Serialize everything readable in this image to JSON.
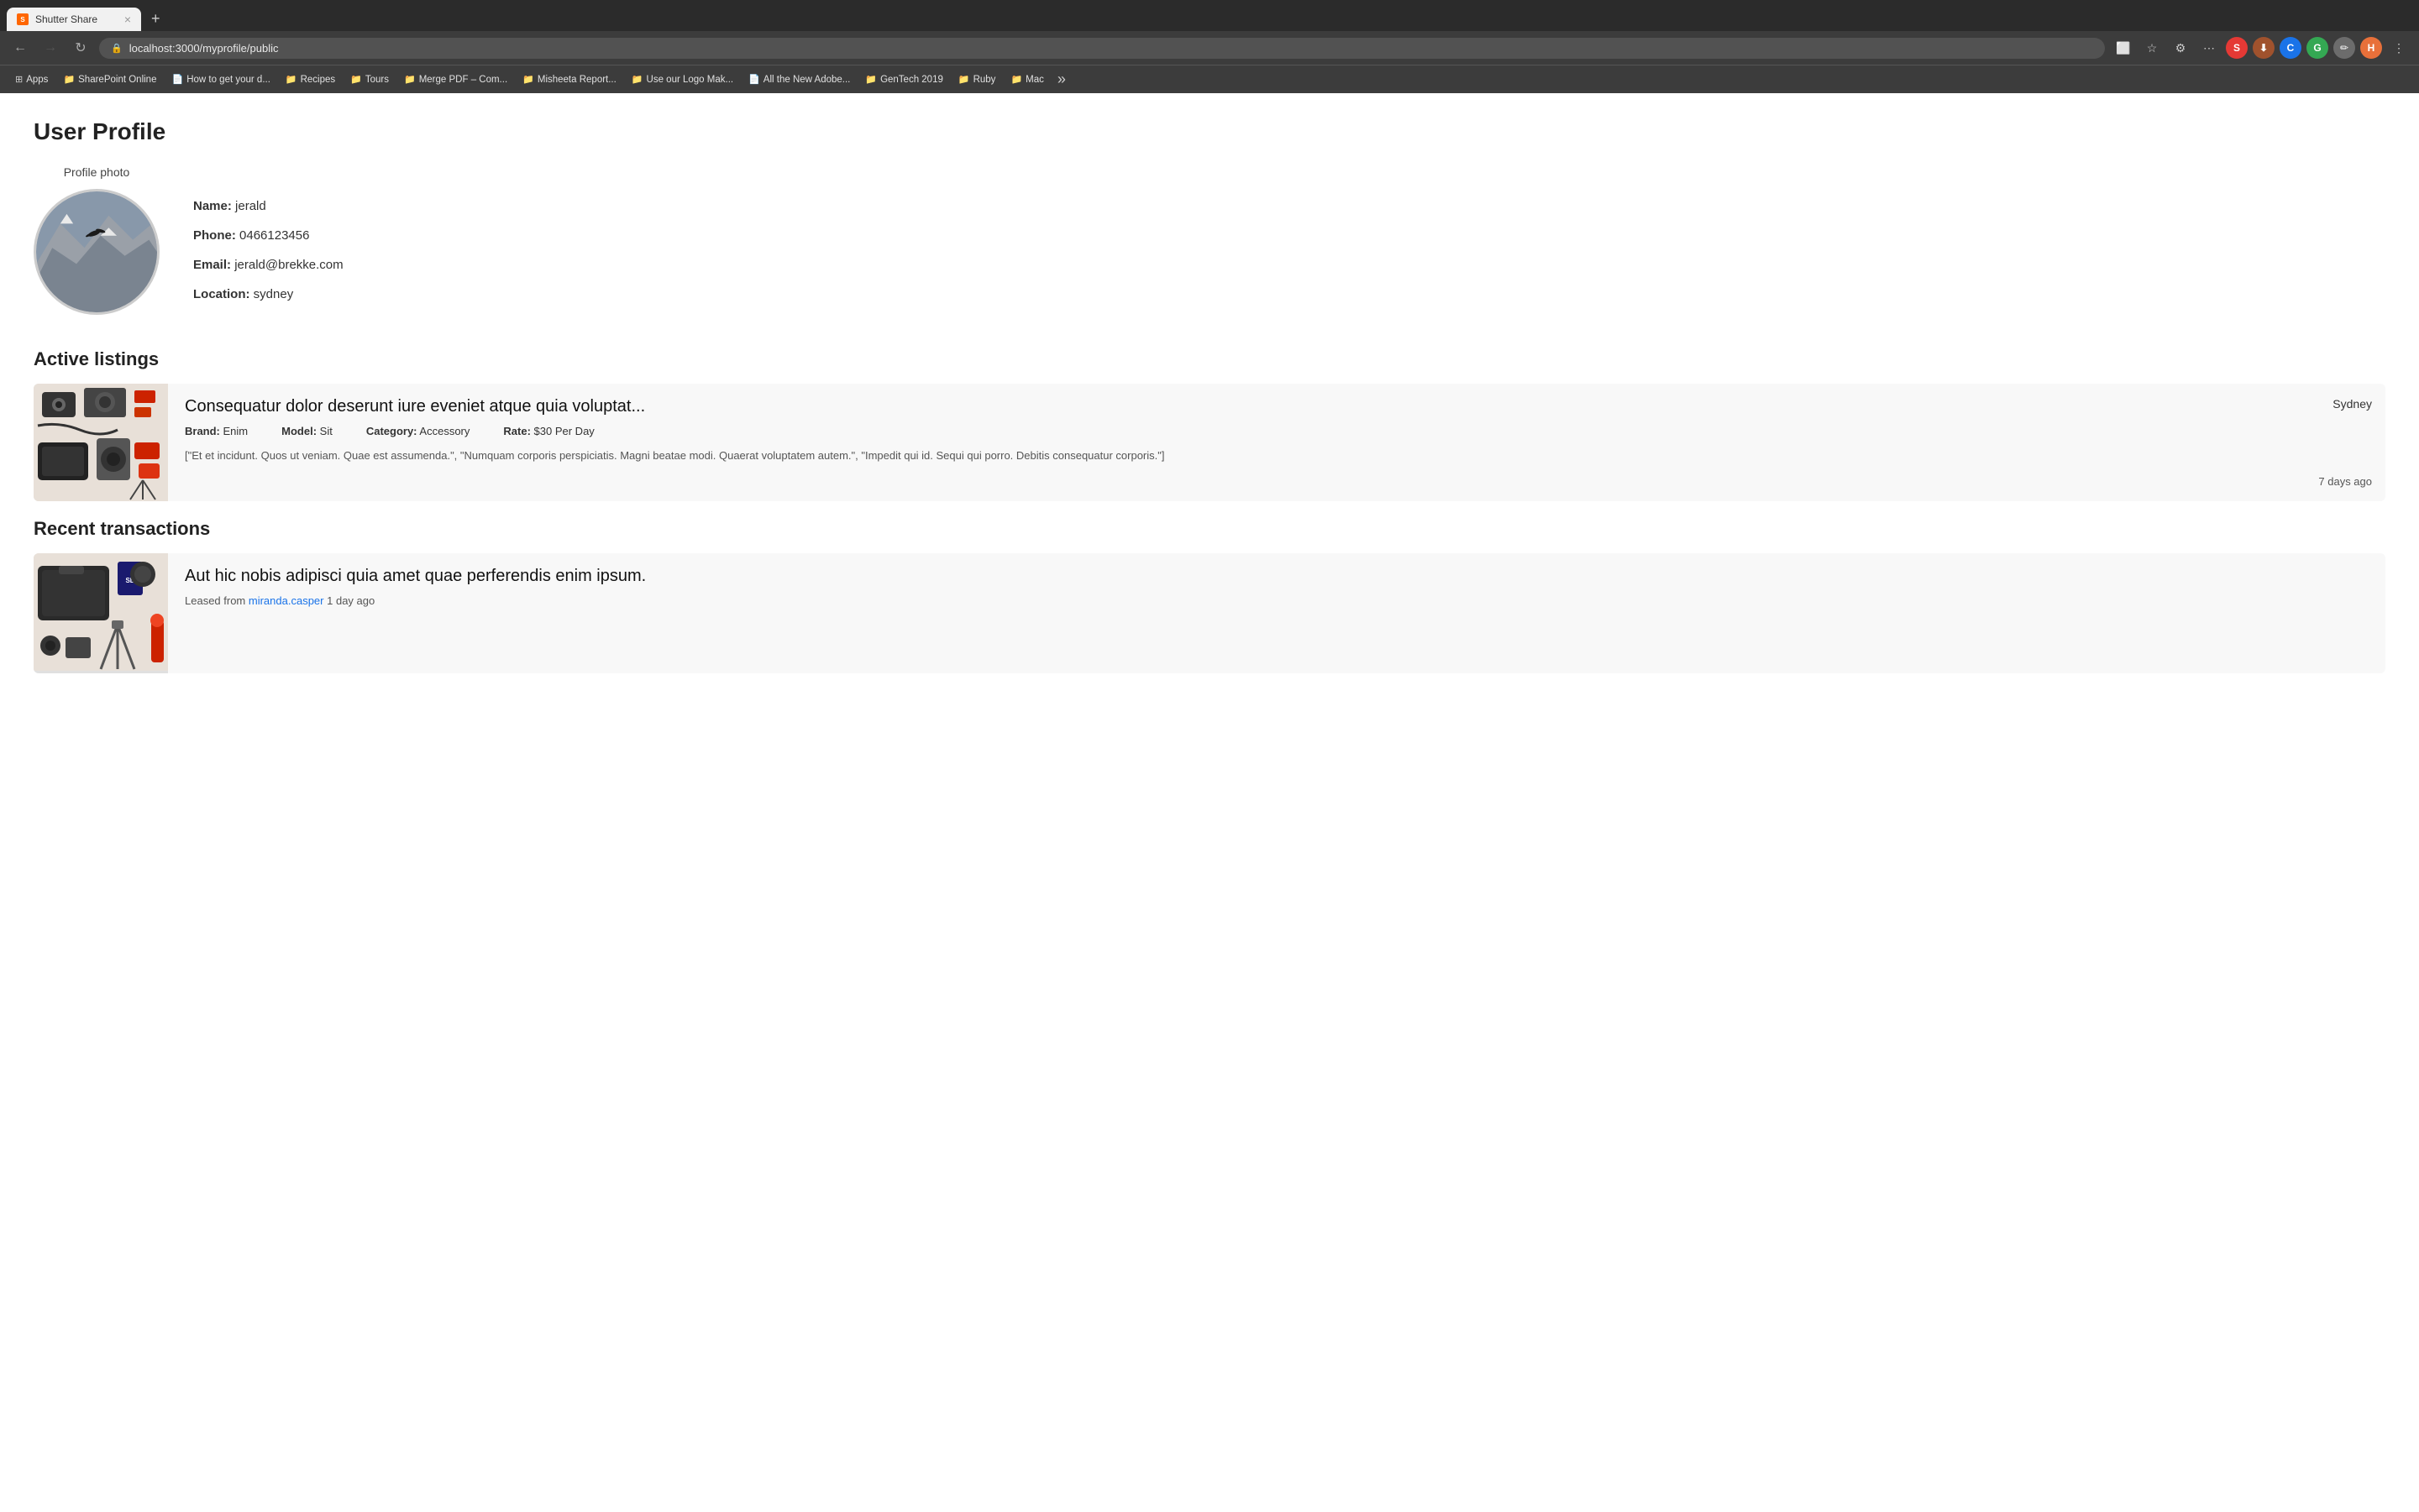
{
  "browser": {
    "tab_title": "Shutter Share",
    "tab_favicon": "S",
    "url": "localhost:3000/myprofile/public",
    "new_tab_label": "+",
    "nav": {
      "back_disabled": false,
      "forward_disabled": true
    },
    "actions": {
      "cast": "⬜",
      "bookmark": "☆",
      "extensions": "⚙",
      "more": "⋯"
    },
    "profiles": {
      "s": "S",
      "c": "C",
      "g": "G",
      "pen": "✏",
      "h": "H"
    },
    "bookmarks": [
      {
        "label": "Apps",
        "icon": "⊞"
      },
      {
        "label": "SharePoint Online",
        "icon": "📁"
      },
      {
        "label": "How to get your d...",
        "icon": "📄"
      },
      {
        "label": "Recipes",
        "icon": "📁"
      },
      {
        "label": "Tours",
        "icon": "📁"
      },
      {
        "label": "Merge PDF – Com...",
        "icon": "📁"
      },
      {
        "label": "Misheeta Report...",
        "icon": "📁"
      },
      {
        "label": "Use our Logo Mak...",
        "icon": "📁"
      },
      {
        "label": "All the New Adobe...",
        "icon": "📄"
      },
      {
        "label": "GenTech 2019",
        "icon": "📁"
      },
      {
        "label": "Ruby",
        "icon": "📁"
      },
      {
        "label": "Mac",
        "icon": "📁"
      }
    ]
  },
  "page": {
    "title": "User Profile",
    "profile": {
      "photo_label": "Profile photo",
      "name_label": "Name:",
      "name_value": "jerald",
      "phone_label": "Phone:",
      "phone_value": "0466123456",
      "email_label": "Email:",
      "email_value": "jerald@brekke.com",
      "location_label": "Location:",
      "location_value": "sydney"
    },
    "active_listings": {
      "section_title": "Active listings",
      "items": [
        {
          "title": "Consequatur dolor deserunt iure eveniet atque quia voluptat...",
          "brand_label": "Brand:",
          "brand_value": "Enim",
          "model_label": "Model:",
          "model_value": "Sit",
          "category_label": "Category:",
          "category_value": "Accessory",
          "rate_label": "Rate:",
          "rate_value": "$30 Per Day",
          "description": "[\"Et et incidunt. Quos ut veniam. Quae est assumenda.\", \"Numquam corporis perspiciatis. Magni beatae modi. Quaerat voluptatem autem.\", \"Impedit qui id. Sequi qui porro. Debitis consequatur corporis.\"]",
          "location": "Sydney",
          "time_ago": "7 days ago"
        }
      ]
    },
    "recent_transactions": {
      "section_title": "Recent transactions",
      "items": [
        {
          "title": "Aut hic nobis adipisci quia amet quae perferendis enim ipsum.",
          "leased_from_label": "Leased from",
          "leased_from_user": "miranda.casper",
          "time_ago": "1 day ago"
        }
      ]
    }
  }
}
